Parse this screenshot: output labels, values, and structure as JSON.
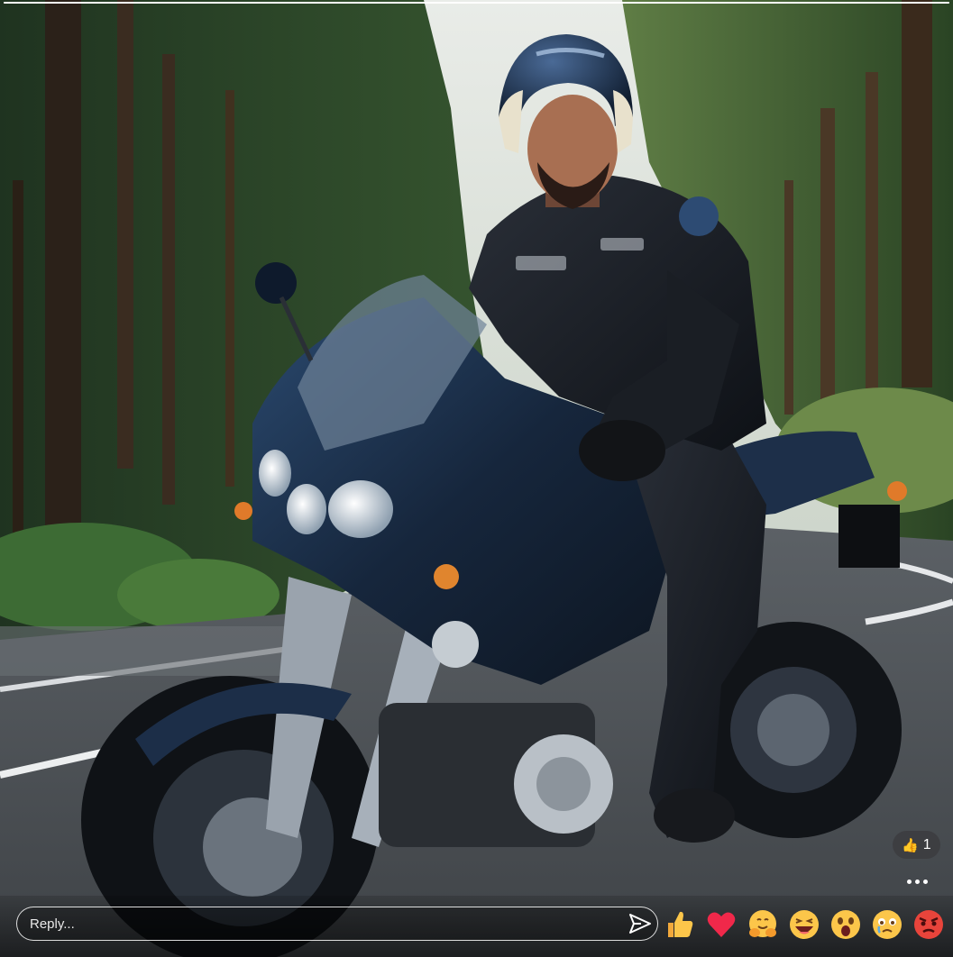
{
  "story": {
    "progress": 1.0
  },
  "reaction_summary": {
    "icon": "thumbs-up-icon",
    "count": "1"
  },
  "more_options": {
    "icon": "more-horizontal-icon"
  },
  "reply": {
    "placeholder": "Reply...",
    "value": "",
    "send_icon": "send-icon"
  },
  "quick_reactions": [
    {
      "name": "like",
      "icon": "thumbs-up-emoji",
      "color": "#f6c343"
    },
    {
      "name": "love",
      "icon": "red-heart-emoji",
      "color": "#f0284a"
    },
    {
      "name": "care",
      "icon": "hugging-face-emoji",
      "color": "#f7b93d"
    },
    {
      "name": "haha",
      "icon": "laughing-face-emoji",
      "color": "#f7c840"
    },
    {
      "name": "wow",
      "icon": "surprised-face-emoji",
      "color": "#f7c840"
    },
    {
      "name": "sad",
      "icon": "crying-face-emoji",
      "color": "#f7c840"
    },
    {
      "name": "angry",
      "icon": "angry-face-emoji",
      "color": "#e8443b"
    }
  ],
  "colors": {
    "overlay_bar": "#000000",
    "text": "#ffffff"
  }
}
